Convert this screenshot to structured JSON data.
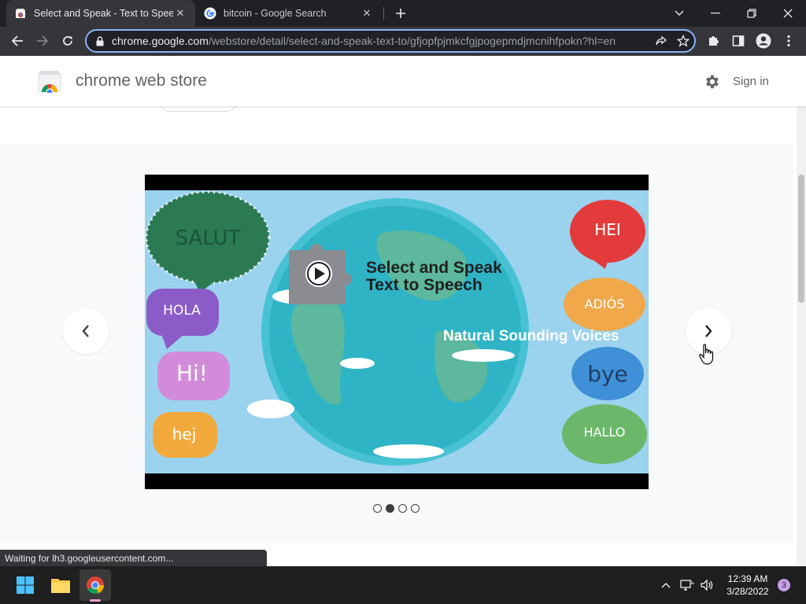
{
  "browser": {
    "tabs": [
      {
        "title": "Select and Speak - Text to Speech",
        "active": true,
        "favicon": "chrome-web-store-icon"
      },
      {
        "title": "bitcoin - Google Search",
        "active": false,
        "favicon": "google-icon"
      }
    ],
    "url": {
      "host": "chrome.google.com",
      "path": "/webstore/detail/select-and-speak-text-to/gfjopfpjmkcfgjpogepmdjmcnihfpokn?hl=en"
    }
  },
  "store": {
    "title": "chrome web store",
    "signin_label": "Sign in"
  },
  "video": {
    "bubbles": [
      "SALUT",
      "HOLA",
      "Hi!",
      "hej",
      "HEI",
      "ADIÓS",
      "bye",
      "HALLO"
    ],
    "headline_line1": "Select and Speak",
    "headline_line2": "Text to Speech",
    "tagline": "Natural Sounding Voices"
  },
  "carousel": {
    "slide_count": 4,
    "active_index": 1
  },
  "status_text": "Waiting for lh3.googleusercontent.com...",
  "taskbar": {
    "time": "12:39 AM",
    "date": "3/28/2022",
    "notification_count": "3"
  },
  "colors": {
    "accent": "#8ab4f8",
    "tab_strip": "#202124",
    "toolbar": "#35363a"
  }
}
